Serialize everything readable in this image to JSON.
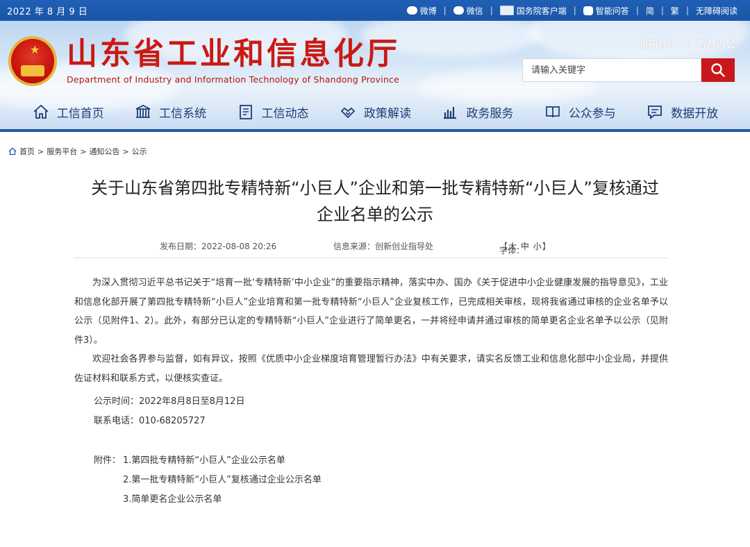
{
  "topbar": {
    "date": "2022 年 8 月 9 日",
    "links": [
      "微博",
      "微信",
      "国务院客户端",
      "智能问答",
      "简",
      "繁",
      "无障碍阅读"
    ]
  },
  "header": {
    "title": "山东省工业和信息化厅",
    "subtitle": "Department of Industry and Information Technology of Shandong Province",
    "mail_login": "邮箱登录",
    "smart_office": "智慧办公",
    "search_placeholder": "请输入关键字"
  },
  "nav": {
    "items": [
      "工信首页",
      "工信系统",
      "工信动态",
      "政策解读",
      "政务服务",
      "公众参与",
      "数据开放"
    ]
  },
  "breadcrumb": {
    "home": "首页",
    "service": "服务平台",
    "notice": "通知公告",
    "current": "公示"
  },
  "article": {
    "title": "关于山东省第四批专精特新“小巨人”企业和第一批专精特新“小巨人”复核通过企业名单的公示",
    "publish": "发布日期：2022-08-08 20:26",
    "source": "信息来源：创新创业指导处",
    "font_label": "字体：",
    "font_large": "大",
    "font_medium": "中",
    "font_small": "小",
    "para1": "为深入贯彻习近平总书记关于“培育一批‘专精特新’中小企业”的重要指示精神，落实中办、国办《关于促进中小企业健康发展的指导意见》，工业和信息化部开展了第四批专精特新“小巨人”企业培育和第一批专精特新“小巨人”企业复核工作，已完成相关审核，现将我省通过审核的企业名单予以公示（见附件1、2）。此外，有部分已认定的专精特新“小巨人”企业进行了简单更名，一并将经申请并通过审核的简单更名企业名单予以公示（见附件3）。",
    "para2": "欢迎社会各界参与监督，如有异议，按照《优质中小企业梯度培育管理暂行办法》中有关要求，请实名反馈工业和信息化部中小企业局，并提供佐证材料和联系方式，以便核实查证。",
    "period": "公示时间：2022年8月8日至8月12日",
    "phone": "联系电话：010-68205727",
    "attach_label": "附件：",
    "attachments": [
      "1.第四批专精特新“小巨人”企业公示名单",
      "2.第一批专精特新“小巨人”复核通过企业公示名单",
      "3.简单更名企业公示名单"
    ]
  }
}
